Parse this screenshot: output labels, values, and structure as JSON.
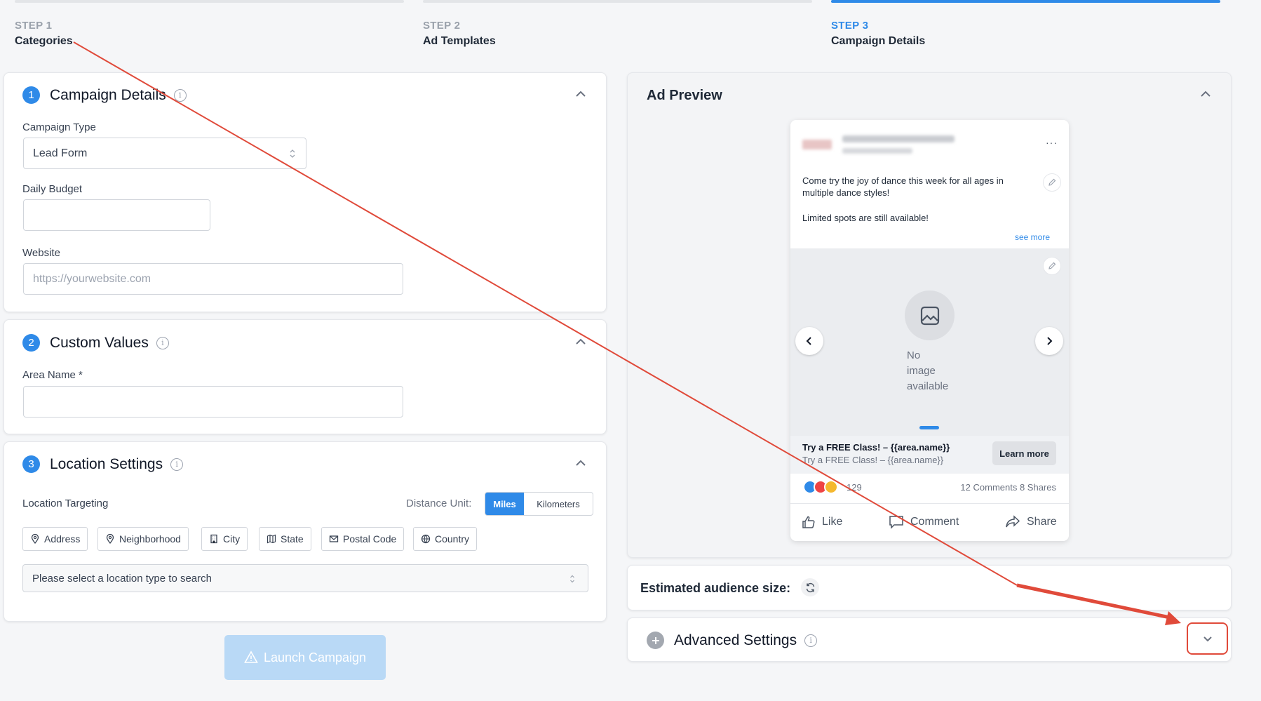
{
  "steps": [
    {
      "label": "STEP 1",
      "name": "Categories"
    },
    {
      "label": "STEP 2",
      "name": "Ad Templates"
    },
    {
      "label": "STEP 3",
      "name": "Campaign Details"
    }
  ],
  "campaign_details": {
    "number": "1",
    "title": "Campaign Details",
    "campaign_type_label": "Campaign Type",
    "campaign_type_value": "Lead Form",
    "daily_budget_label": "Daily Budget",
    "daily_budget_value": "",
    "website_label": "Website",
    "website_placeholder": "https://yourwebsite.com"
  },
  "custom_values": {
    "number": "2",
    "title": "Custom Values",
    "area_name_label": "Area Name *",
    "area_name_value": ""
  },
  "location_settings": {
    "number": "3",
    "title": "Location Settings",
    "targeting_label": "Location Targeting",
    "distance_unit_label": "Distance Unit:",
    "units": [
      "Miles",
      "Kilometers"
    ],
    "selected_unit": "Miles",
    "types": [
      "Address",
      "Neighborhood",
      "City",
      "State",
      "Postal Code",
      "Country"
    ],
    "search_placeholder": "Please select a location type to search"
  },
  "launch_label": "Launch Campaign",
  "ad_preview": {
    "title": "Ad Preview",
    "post_text_1": "Come try the joy of dance this week for all ages in multiple dance styles!",
    "post_text_2": "Limited spots are still available!",
    "see_more": "see more",
    "no_image": [
      "No",
      "image",
      "available"
    ],
    "headline": "Try a FREE Class! – {{area.name}}",
    "subline": "Try a FREE Class! – {{area.name}}",
    "cta": "Learn more",
    "reaction_count": "129",
    "comments_shares": "12 Comments 8 Shares",
    "actions": [
      "Like",
      "Comment",
      "Share"
    ]
  },
  "audience": {
    "label": "Estimated audience size:"
  },
  "advanced": {
    "title": "Advanced Settings"
  },
  "colors": {
    "accent": "#2f8ae8",
    "annotation": "#e04a3a"
  }
}
